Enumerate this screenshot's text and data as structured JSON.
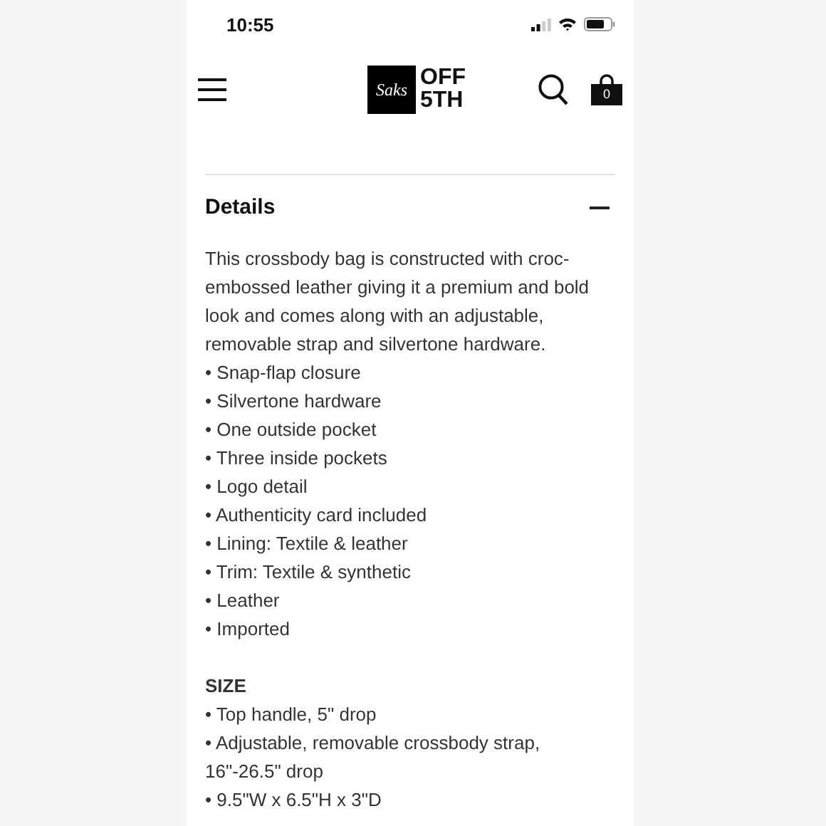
{
  "status_bar": {
    "time": "10:55"
  },
  "header": {
    "logo": {
      "script": "Saks",
      "line_1": "OFF",
      "line_2": "5TH"
    },
    "cart_count": "0"
  },
  "details": {
    "title": "Details",
    "expanded": true,
    "description": "This crossbody bag is constructed with croc-embossed leather giving it a premium and bold look and comes along with an adjustable, removable strap and silvertone hardware.",
    "items": [
      "• Snap-flap closure",
      "• Silvertone hardware",
      "• One outside pocket",
      "• Three inside pockets",
      "• Logo detail",
      "• Authenticity card included",
      "• Lining: Textile & leather",
      "• Trim: Textile & synthetic",
      "• Leather",
      "• Imported"
    ],
    "size_heading": "SIZE",
    "size_items": [
      "• Top handle, 5\" drop",
      "• Adjustable, removable crossbody strap, 16\"-26.5\" drop",
      "• 9.5\"W x 6.5\"H x 3\"D"
    ]
  }
}
